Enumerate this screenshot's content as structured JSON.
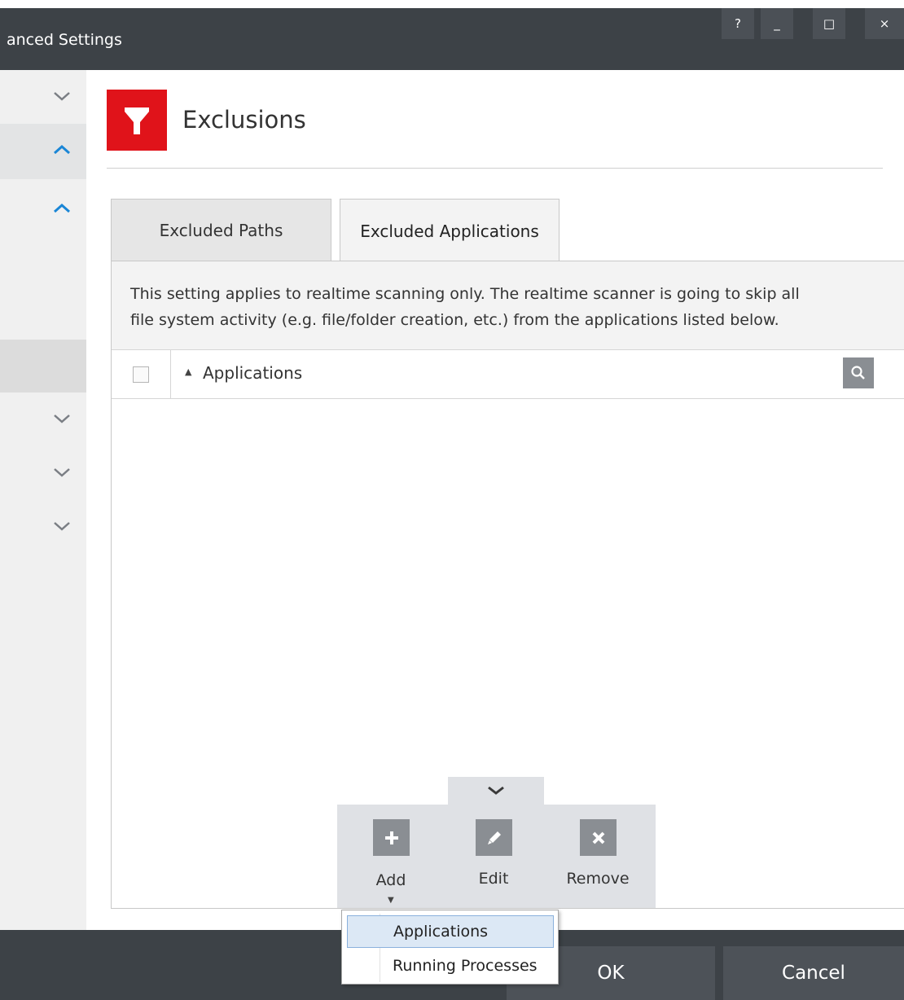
{
  "window": {
    "title": "anced Settings",
    "controls": {
      "help": "?",
      "minimize": "_",
      "maximize": "□",
      "close": "×"
    }
  },
  "sidebar": {
    "items": [
      {
        "state": "collapsed",
        "icon": "chevron-down-icon"
      },
      {
        "state": "expanded",
        "icon": "chevron-up-icon",
        "highlighted": true
      },
      {
        "state": "expanded",
        "icon": "chevron-up-icon"
      },
      {
        "state": "selected-blank"
      },
      {
        "state": "collapsed",
        "icon": "chevron-down-icon"
      },
      {
        "state": "collapsed",
        "icon": "chevron-down-icon"
      },
      {
        "state": "collapsed",
        "icon": "chevron-down-icon"
      }
    ]
  },
  "header": {
    "title": "Exclusions",
    "icon": "funnel-icon",
    "icon_color": "#e0131a"
  },
  "tabs": [
    {
      "label": "Excluded Paths",
      "active": false
    },
    {
      "label": "Excluded Applications",
      "active": true
    }
  ],
  "panel": {
    "description_line1": "This setting applies to realtime scanning only. The realtime scanner is going to skip all",
    "description_line2": "file system activity (e.g. file/folder creation, etc.) from the applications listed below.",
    "list": {
      "column": "Applications",
      "sort": "ascending",
      "rows": []
    }
  },
  "toolbar": {
    "collapse_icon": "chevron-down-icon",
    "add_label": "Add",
    "edit_label": "Edit",
    "remove_label": "Remove"
  },
  "add_menu": {
    "items": [
      {
        "label": "Applications",
        "selected": true
      },
      {
        "label": "Running Processes",
        "selected": false
      }
    ]
  },
  "footer": {
    "ok_label": "OK",
    "cancel_label": "Cancel"
  },
  "colors": {
    "titlebar": "#3d4247",
    "accent_red": "#e0131a",
    "chevron_blue": "#1a86d6",
    "chevron_gray": "#7a7e84",
    "menu_highlight": "#dce8f5"
  }
}
